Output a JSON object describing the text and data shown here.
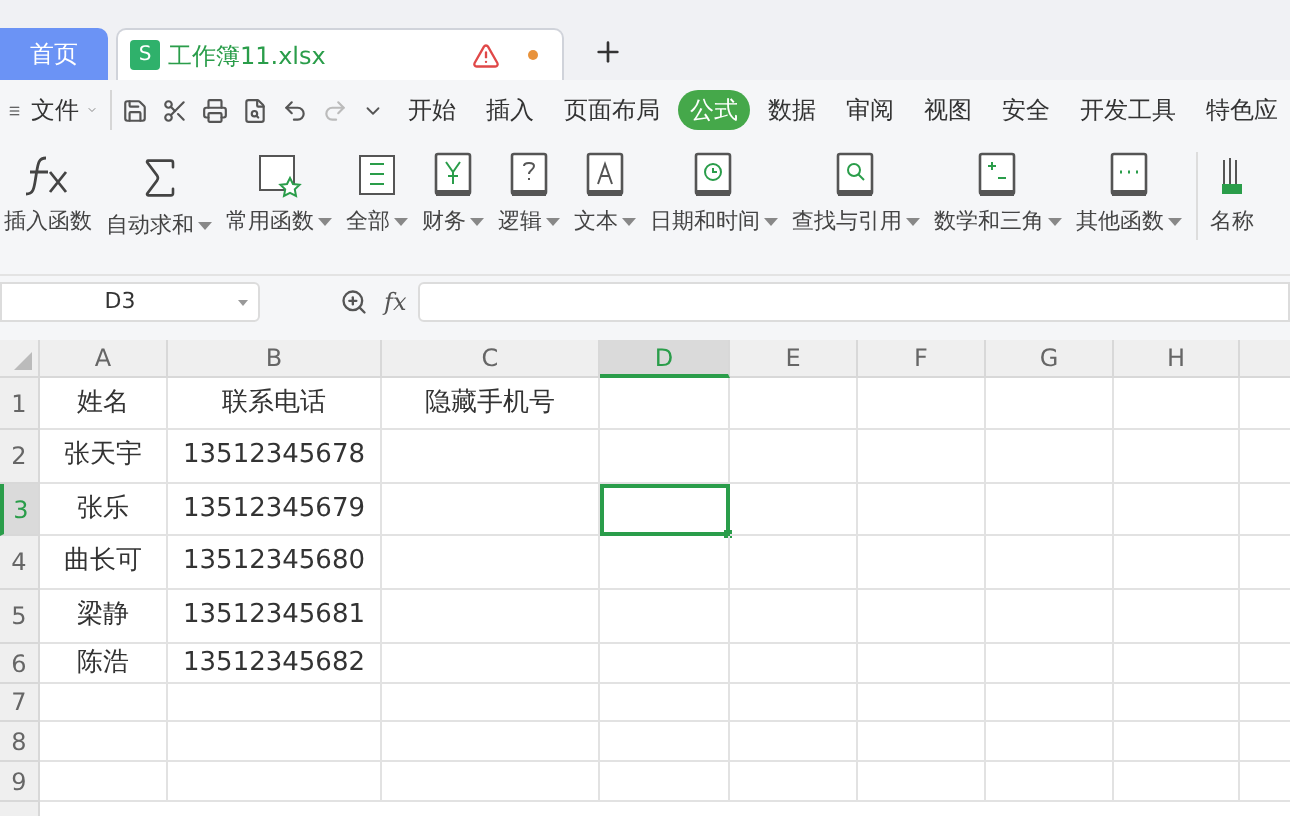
{
  "tabs": [
    {
      "label": "首页",
      "selected": false
    },
    {
      "label": "工作簿11.xlsx",
      "logo": "S",
      "selected": true,
      "warning": true,
      "modified": true
    }
  ],
  "menu": {
    "file": "文件",
    "tabs": [
      {
        "label": "开始",
        "selected": false
      },
      {
        "label": "插入",
        "selected": false
      },
      {
        "label": "页面布局",
        "selected": false
      },
      {
        "label": "公式",
        "selected": true
      },
      {
        "label": "数据",
        "selected": false
      },
      {
        "label": "审阅",
        "selected": false
      },
      {
        "label": "视图",
        "selected": false
      },
      {
        "label": "安全",
        "selected": false
      },
      {
        "label": "开发工具",
        "selected": false
      },
      {
        "label": "特色应",
        "selected": false
      }
    ]
  },
  "ribbon": [
    {
      "label": "插入函数",
      "dropdown": false
    },
    {
      "label": "自动求和",
      "dropdown": true
    },
    {
      "label": "常用函数",
      "dropdown": true
    },
    {
      "label": "全部",
      "dropdown": true
    },
    {
      "label": "财务",
      "dropdown": true
    },
    {
      "label": "逻辑",
      "dropdown": true
    },
    {
      "label": "文本",
      "dropdown": true
    },
    {
      "label": "日期和时间",
      "dropdown": true
    },
    {
      "label": "查找与引用",
      "dropdown": true
    },
    {
      "label": "数学和三角",
      "dropdown": true
    },
    {
      "label": "其他函数",
      "dropdown": true
    },
    {
      "label": "名称",
      "dropdown": false
    }
  ],
  "formula_bar": {
    "name_box": "D3",
    "fx": "fx"
  },
  "columns": [
    {
      "label": "A",
      "selected": false
    },
    {
      "label": "B",
      "selected": false
    },
    {
      "label": "C",
      "selected": false
    },
    {
      "label": "D",
      "selected": true
    },
    {
      "label": "E",
      "selected": false
    },
    {
      "label": "F",
      "selected": false
    },
    {
      "label": "G",
      "selected": false
    },
    {
      "label": "H",
      "selected": false
    }
  ],
  "rows": [
    {
      "label": "1",
      "selected": false,
      "cells": [
        "姓名",
        "联系电话",
        "隐藏手机号"
      ]
    },
    {
      "label": "2",
      "selected": false,
      "cells": [
        "张天宇",
        "13512345678"
      ]
    },
    {
      "label": "3",
      "selected": true,
      "cells": [
        "张乐",
        "13512345679"
      ]
    },
    {
      "label": "4",
      "selected": false,
      "cells": [
        "曲长可",
        "13512345680"
      ]
    },
    {
      "label": "5",
      "selected": false,
      "cells": [
        "梁静",
        "13512345681"
      ]
    },
    {
      "label": "6",
      "selected": false,
      "cells": [
        "陈浩",
        "13512345682"
      ]
    },
    {
      "label": "7",
      "selected": false,
      "cells": []
    },
    {
      "label": "8",
      "selected": false,
      "cells": []
    },
    {
      "label": "9",
      "selected": false,
      "cells": []
    }
  ]
}
